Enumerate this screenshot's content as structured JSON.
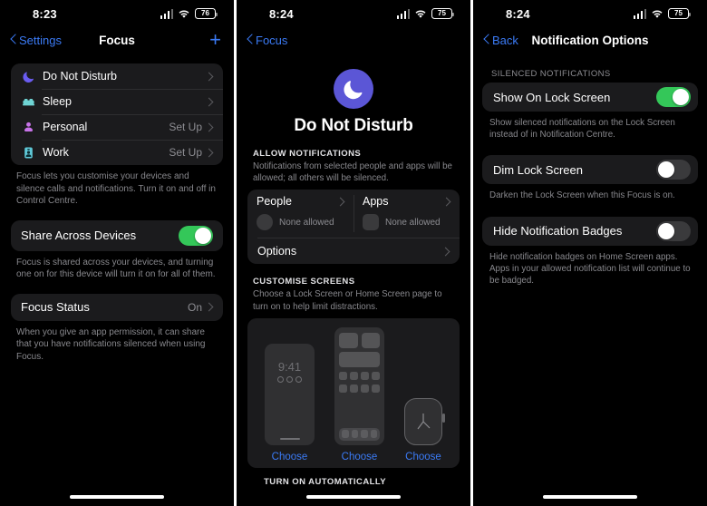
{
  "panels": [
    {
      "name": "focus-list",
      "status": {
        "time": "8:23",
        "battery": "76",
        "wifi_icon": "wifi-icon",
        "cellular_icon": "cellular-bars-icon"
      },
      "nav": {
        "back_label": "Settings",
        "title": "Focus",
        "add_label": "+"
      },
      "focus_modes": [
        {
          "label": "Do Not Disturb",
          "value": "",
          "icon": "moon-icon",
          "color": "#6a5cf0"
        },
        {
          "label": "Sleep",
          "value": "",
          "icon": "bed-icon",
          "color": "#6fd4d4"
        },
        {
          "label": "Personal",
          "value": "Set Up",
          "icon": "person-icon",
          "color": "#c773e8"
        },
        {
          "label": "Work",
          "value": "Set Up",
          "icon": "id-badge-icon",
          "color": "#5fc9d8"
        }
      ],
      "focus_footnote": "Focus lets you customise your devices and silence calls and notifications. Turn it on and off in Control Centre.",
      "share": {
        "label": "Share Across Devices",
        "state": "on"
      },
      "share_footnote": "Focus is shared across your devices, and turning one on for this device will turn it on for all of them.",
      "status_row": {
        "label": "Focus Status",
        "value": "On"
      },
      "status_footnote": "When you give an app permission, it can share that you have notifications silenced when using Focus."
    },
    {
      "name": "do-not-disturb-detail",
      "status": {
        "time": "8:24",
        "battery": "75"
      },
      "nav": {
        "back_label": "Focus"
      },
      "hero": {
        "title": "Do Not Disturb",
        "icon": "moon-icon",
        "circle_color": "#5b56d6"
      },
      "allow": {
        "heading": "ALLOW NOTIFICATIONS",
        "subtitle": "Notifications from selected people and apps will be allowed; all others will be silenced.",
        "people": {
          "label": "People",
          "value": "None allowed"
        },
        "apps": {
          "label": "Apps",
          "value": "None allowed"
        },
        "options_label": "Options"
      },
      "customise": {
        "heading": "CUSTOMISE SCREENS",
        "subtitle": "Choose a Lock Screen or Home Screen page to turn on to help limit distractions.",
        "lock_time": "9:41",
        "choose_lock": "Choose",
        "choose_home": "Choose",
        "choose_watch": "Choose"
      },
      "turn_on_heading": "TURN ON AUTOMATICALLY"
    },
    {
      "name": "notification-options",
      "status": {
        "time": "8:24",
        "battery": "75"
      },
      "nav": {
        "back_label": "Back",
        "title": "Notification Options"
      },
      "section_heading": "SILENCED NOTIFICATIONS",
      "options": [
        {
          "label": "Show On Lock Screen",
          "state": "on",
          "description": "Show silenced notifications on the Lock Screen instead of in Notification Centre."
        },
        {
          "label": "Dim Lock Screen",
          "state": "off",
          "description": "Darken the Lock Screen when this Focus is on."
        },
        {
          "label": "Hide Notification Badges",
          "state": "off",
          "description": "Hide notification badges on Home Screen apps. Apps in your allowed notification list will continue to be badged."
        }
      ]
    }
  ],
  "colors": {
    "accent_blue": "#3b7bf6",
    "toggle_on": "#34c759",
    "toggle_off": "#3a3a3c",
    "card": "#1b1b1d"
  }
}
